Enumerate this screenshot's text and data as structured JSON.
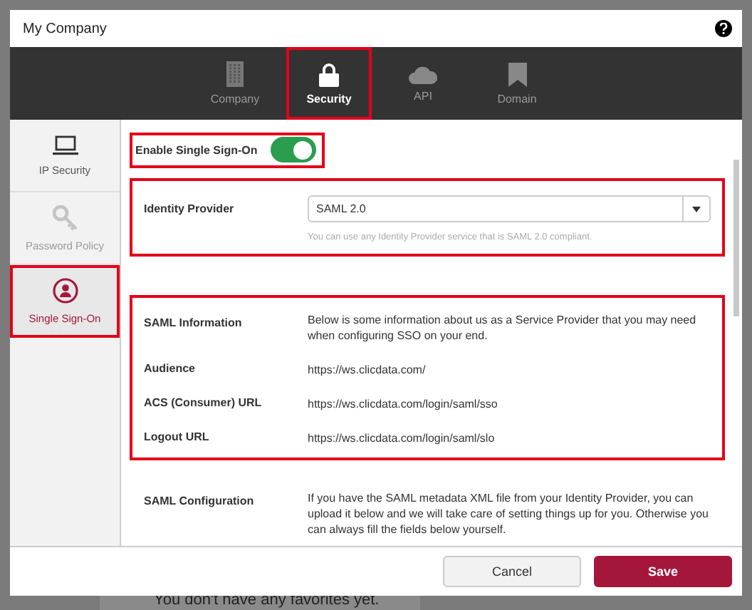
{
  "window": {
    "title": "My Company"
  },
  "tabs": [
    {
      "label": "Company",
      "kind": "building",
      "selected": false,
      "highlighted": false
    },
    {
      "label": "Security",
      "kind": "lock",
      "selected": true,
      "highlighted": true
    },
    {
      "label": "API",
      "kind": "cloud",
      "selected": false,
      "highlighted": false
    },
    {
      "label": "Domain",
      "kind": "bookmark",
      "selected": false,
      "highlighted": false
    }
  ],
  "sidebar": {
    "items": [
      {
        "label": "IP Security",
        "kind": "laptop",
        "selected": false,
        "disabled": false,
        "highlighted": false
      },
      {
        "label": "Password Policy",
        "kind": "key",
        "selected": false,
        "disabled": true,
        "highlighted": false
      },
      {
        "label": "Single Sign-On",
        "kind": "user",
        "selected": true,
        "disabled": false,
        "highlighted": true
      }
    ]
  },
  "sso_toggle": {
    "label": "Enable Single Sign-On",
    "on": true,
    "highlighted": true
  },
  "identity_provider": {
    "label": "Identity Provider",
    "value": "SAML 2.0",
    "hint": "You can use any Identity Provider service that is SAML 2.0 compliant.",
    "highlighted": true
  },
  "saml_information": {
    "highlighted": true,
    "rows": [
      {
        "label": "SAML Information",
        "value": "Below is some information about us as a Service Provider that you may need when configuring SSO on your end."
      },
      {
        "label": "Audience",
        "value": "https://ws.clicdata.com/"
      },
      {
        "label": "ACS (Consumer) URL",
        "value": "https://ws.clicdata.com/login/saml/sso"
      },
      {
        "label": "Logout URL",
        "value": "https://ws.clicdata.com/login/saml/slo"
      }
    ]
  },
  "saml_configuration": {
    "label": "SAML Configuration",
    "value": "If you have the SAML metadata XML file from your Identity Provider, you can upload it below and we will take care of setting things up for you. Otherwise you can always fill the fields below yourself."
  },
  "buttons": [
    {
      "label": "Cancel",
      "kind": "secondary"
    },
    {
      "label": "Save",
      "kind": "primary"
    }
  ],
  "background_text": "You don't have any favorites yet."
}
